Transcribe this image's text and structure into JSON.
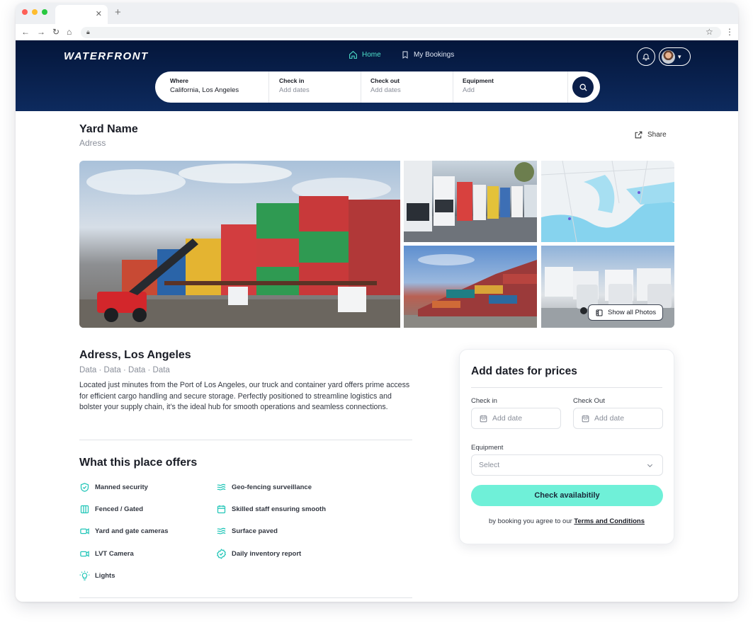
{
  "header": {
    "logo": "WATERFRONT",
    "nav": {
      "home": "Home",
      "bookings": "My Bookings"
    }
  },
  "search": {
    "where": {
      "label": "Where",
      "value": "California, Los Angeles"
    },
    "checkin": {
      "label": "Check in",
      "placeholder": "Add dates"
    },
    "checkout": {
      "label": "Check out",
      "placeholder": "Add dates"
    },
    "equipment": {
      "label": "Equipment",
      "placeholder": "Add"
    }
  },
  "listing": {
    "name": "Yard Name",
    "address": "Adress",
    "share": "Share",
    "show_all_photos": "Show all Photos",
    "address_title": "Adress, Los Angeles",
    "meta": "Data · Data · Data · Data",
    "description": "Located just minutes from the Port of Los Angeles, our truck and container yard offers prime access for efficient cargo handling and secure storage. Perfectly positioned to streamline logistics and bolster your supply chain, it’s the ideal hub for smooth operations and seamless connections."
  },
  "offers": {
    "title": "What this place offers",
    "left": [
      {
        "label": "Manned security",
        "icon": "shield-check-icon"
      },
      {
        "label": "Fenced / Gated",
        "icon": "fence-icon"
      },
      {
        "label": "Yard and gate cameras",
        "icon": "video-camera-icon"
      },
      {
        "label": "LVT Camera",
        "icon": "video-camera-icon"
      },
      {
        "label": "Lights",
        "icon": "lightbulb-icon"
      }
    ],
    "right": [
      {
        "label": "Geo-fencing surveillance",
        "icon": "waves-icon"
      },
      {
        "label": "Skilled staff ensuring smooth",
        "icon": "calendar-icon"
      },
      {
        "label": "Surface paved",
        "icon": "waves-icon"
      },
      {
        "label": "Daily inventory report",
        "icon": "badge-check-icon"
      }
    ]
  },
  "booking": {
    "title": "Add dates for prices",
    "checkin_label": "Check in",
    "checkout_label": "Check Out",
    "date_placeholder": "Add date",
    "equipment_label": "Equipment",
    "equipment_placeholder": "Select",
    "button": "Check availabitily",
    "terms_prefix": "by booking you agree to our ",
    "terms_link": "Terms and Conditions"
  },
  "colors": {
    "header_dark": "#04163a",
    "accent": "#4ee1cc",
    "button": "#6ff0d8",
    "icon": "#22c6b8"
  }
}
